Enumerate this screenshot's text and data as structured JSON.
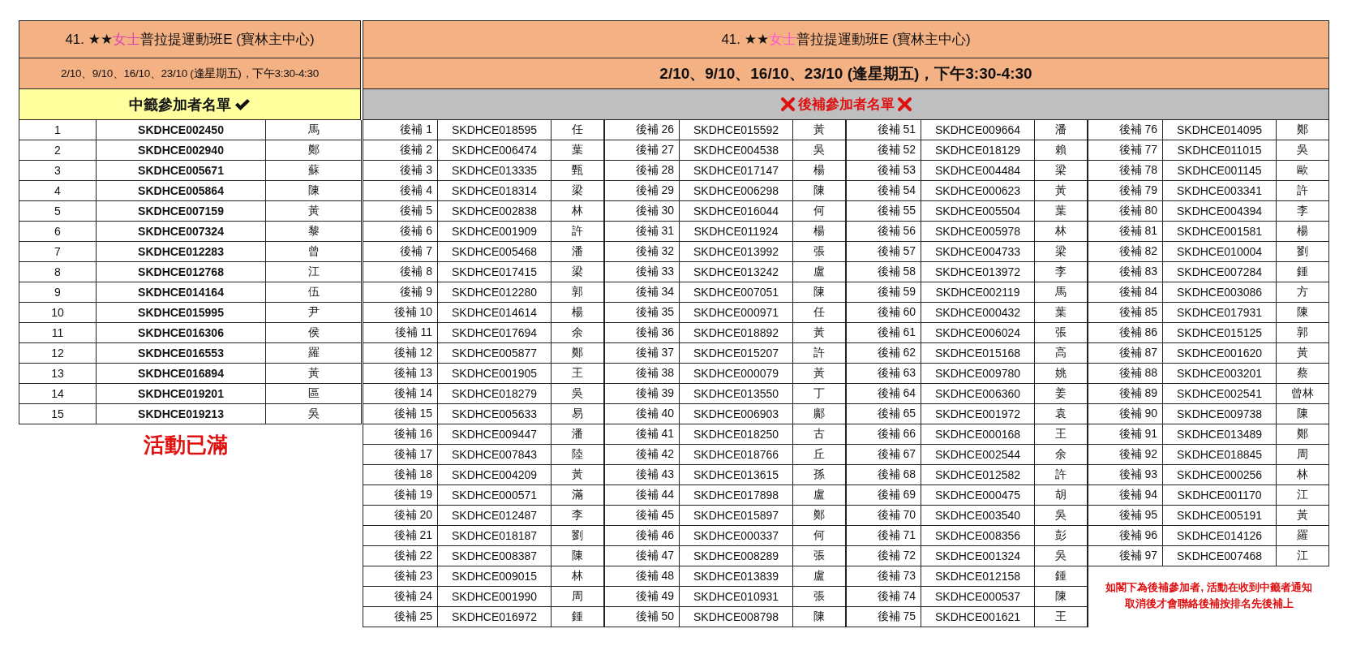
{
  "winners": {
    "title": {
      "prefix": "41. ★★",
      "highlight": "女士",
      "suffix": "普拉提運動班E (寶林主中心)"
    },
    "schedule": "2/10、9/10、16/10、23/10 (逢星期五)，下午3:30-4:30",
    "heading": "中籤參加者名單",
    "rows": [
      {
        "no": "1",
        "id": "SKDHCE002450",
        "name": "馬"
      },
      {
        "no": "2",
        "id": "SKDHCE002940",
        "name": "鄭"
      },
      {
        "no": "3",
        "id": "SKDHCE005671",
        "name": "蘇"
      },
      {
        "no": "4",
        "id": "SKDHCE005864",
        "name": "陳"
      },
      {
        "no": "5",
        "id": "SKDHCE007159",
        "name": "黃"
      },
      {
        "no": "6",
        "id": "SKDHCE007324",
        "name": "黎"
      },
      {
        "no": "7",
        "id": "SKDHCE012283",
        "name": "曾"
      },
      {
        "no": "8",
        "id": "SKDHCE012768",
        "name": "江"
      },
      {
        "no": "9",
        "id": "SKDHCE014164",
        "name": "伍"
      },
      {
        "no": "10",
        "id": "SKDHCE015995",
        "name": "尹"
      },
      {
        "no": "11",
        "id": "SKDHCE016306",
        "name": "侯"
      },
      {
        "no": "12",
        "id": "SKDHCE016553",
        "name": "羅"
      },
      {
        "no": "13",
        "id": "SKDHCE016894",
        "name": "黃"
      },
      {
        "no": "14",
        "id": "SKDHCE019201",
        "name": "區"
      },
      {
        "no": "15",
        "id": "SKDHCE019213",
        "name": "吳"
      }
    ],
    "status": "活動已滿"
  },
  "waitlist": {
    "title": {
      "prefix": "41. ★★",
      "highlight": "女士",
      "suffix": "普拉提運動班E (寶林主中心)"
    },
    "schedule": "2/10、9/10、16/10、23/10 (逢星期五)，下午3:30-4:30",
    "heading": "後補參加者名單",
    "groups": [
      {
        "rows": [
          {
            "label": "後補 1",
            "id": "SKDHCE018595",
            "name": "任"
          },
          {
            "label": "後補 2",
            "id": "SKDHCE006474",
            "name": "葉"
          },
          {
            "label": "後補 3",
            "id": "SKDHCE013335",
            "name": "甄"
          },
          {
            "label": "後補 4",
            "id": "SKDHCE018314",
            "name": "梁"
          },
          {
            "label": "後補 5",
            "id": "SKDHCE002838",
            "name": "林"
          },
          {
            "label": "後補 6",
            "id": "SKDHCE001909",
            "name": "許"
          },
          {
            "label": "後補 7",
            "id": "SKDHCE005468",
            "name": "潘"
          },
          {
            "label": "後補 8",
            "id": "SKDHCE017415",
            "name": "梁"
          },
          {
            "label": "後補 9",
            "id": "SKDHCE012280",
            "name": "郭"
          },
          {
            "label": "後補 10",
            "id": "SKDHCE014614",
            "name": "楊"
          },
          {
            "label": "後補 11",
            "id": "SKDHCE017694",
            "name": "余"
          },
          {
            "label": "後補 12",
            "id": "SKDHCE005877",
            "name": "鄭"
          },
          {
            "label": "後補 13",
            "id": "SKDHCE001905",
            "name": "王"
          },
          {
            "label": "後補 14",
            "id": "SKDHCE018279",
            "name": "吳"
          },
          {
            "label": "後補 15",
            "id": "SKDHCE005633",
            "name": "易"
          },
          {
            "label": "後補 16",
            "id": "SKDHCE009447",
            "name": "潘"
          },
          {
            "label": "後補 17",
            "id": "SKDHCE007843",
            "name": "陸"
          },
          {
            "label": "後補 18",
            "id": "SKDHCE004209",
            "name": "黃"
          },
          {
            "label": "後補 19",
            "id": "SKDHCE000571",
            "name": "滿"
          },
          {
            "label": "後補 20",
            "id": "SKDHCE012487",
            "name": "李"
          },
          {
            "label": "後補 21",
            "id": "SKDHCE018187",
            "name": "劉"
          },
          {
            "label": "後補 22",
            "id": "SKDHCE008387",
            "name": "陳"
          },
          {
            "label": "後補 23",
            "id": "SKDHCE009015",
            "name": "林"
          },
          {
            "label": "後補 24",
            "id": "SKDHCE001990",
            "name": "周"
          },
          {
            "label": "後補 25",
            "id": "SKDHCE016972",
            "name": "鍾"
          }
        ]
      },
      {
        "rows": [
          {
            "label": "後補 26",
            "id": "SKDHCE015592",
            "name": "黃"
          },
          {
            "label": "後補 27",
            "id": "SKDHCE004538",
            "name": "吳"
          },
          {
            "label": "後補 28",
            "id": "SKDHCE017147",
            "name": "楊"
          },
          {
            "label": "後補 29",
            "id": "SKDHCE006298",
            "name": "陳"
          },
          {
            "label": "後補 30",
            "id": "SKDHCE016044",
            "name": "何"
          },
          {
            "label": "後補 31",
            "id": "SKDHCE011924",
            "name": "楊"
          },
          {
            "label": "後補 32",
            "id": "SKDHCE013992",
            "name": "張"
          },
          {
            "label": "後補 33",
            "id": "SKDHCE013242",
            "name": "盧"
          },
          {
            "label": "後補 34",
            "id": "SKDHCE007051",
            "name": "陳"
          },
          {
            "label": "後補 35",
            "id": "SKDHCE000971",
            "name": "任"
          },
          {
            "label": "後補 36",
            "id": "SKDHCE018892",
            "name": "黃"
          },
          {
            "label": "後補 37",
            "id": "SKDHCE015207",
            "name": "許"
          },
          {
            "label": "後補 38",
            "id": "SKDHCE000079",
            "name": "黃"
          },
          {
            "label": "後補 39",
            "id": "SKDHCE013550",
            "name": "丁"
          },
          {
            "label": "後補 40",
            "id": "SKDHCE006903",
            "name": "鄺"
          },
          {
            "label": "後補 41",
            "id": "SKDHCE018250",
            "name": "古"
          },
          {
            "label": "後補 42",
            "id": "SKDHCE018766",
            "name": "丘"
          },
          {
            "label": "後補 43",
            "id": "SKDHCE013615",
            "name": "孫"
          },
          {
            "label": "後補 44",
            "id": "SKDHCE017898",
            "name": "盧"
          },
          {
            "label": "後補 45",
            "id": "SKDHCE015897",
            "name": "鄭"
          },
          {
            "label": "後補 46",
            "id": "SKDHCE000337",
            "name": "何"
          },
          {
            "label": "後補 47",
            "id": "SKDHCE008289",
            "name": "張"
          },
          {
            "label": "後補 48",
            "id": "SKDHCE013839",
            "name": "盧"
          },
          {
            "label": "後補 49",
            "id": "SKDHCE010931",
            "name": "張"
          },
          {
            "label": "後補 50",
            "id": "SKDHCE008798",
            "name": "陳"
          }
        ]
      },
      {
        "rows": [
          {
            "label": "後補 51",
            "id": "SKDHCE009664",
            "name": "潘"
          },
          {
            "label": "後補 52",
            "id": "SKDHCE018129",
            "name": "賴"
          },
          {
            "label": "後補 53",
            "id": "SKDHCE004484",
            "name": "梁"
          },
          {
            "label": "後補 54",
            "id": "SKDHCE000623",
            "name": "黃"
          },
          {
            "label": "後補 55",
            "id": "SKDHCE005504",
            "name": "葉"
          },
          {
            "label": "後補 56",
            "id": "SKDHCE005978",
            "name": "林"
          },
          {
            "label": "後補 57",
            "id": "SKDHCE004733",
            "name": "梁"
          },
          {
            "label": "後補 58",
            "id": "SKDHCE013972",
            "name": "李"
          },
          {
            "label": "後補 59",
            "id": "SKDHCE002119",
            "name": "馬"
          },
          {
            "label": "後補 60",
            "id": "SKDHCE000432",
            "name": "葉"
          },
          {
            "label": "後補 61",
            "id": "SKDHCE006024",
            "name": "張"
          },
          {
            "label": "後補 62",
            "id": "SKDHCE015168",
            "name": "高"
          },
          {
            "label": "後補 63",
            "id": "SKDHCE009780",
            "name": "姚"
          },
          {
            "label": "後補 64",
            "id": "SKDHCE006360",
            "name": "姜"
          },
          {
            "label": "後補 65",
            "id": "SKDHCE001972",
            "name": "袁"
          },
          {
            "label": "後補 66",
            "id": "SKDHCE000168",
            "name": "王"
          },
          {
            "label": "後補 67",
            "id": "SKDHCE002544",
            "name": "余"
          },
          {
            "label": "後補 68",
            "id": "SKDHCE012582",
            "name": "許"
          },
          {
            "label": "後補 69",
            "id": "SKDHCE000475",
            "name": "胡"
          },
          {
            "label": "後補 70",
            "id": "SKDHCE003540",
            "name": "吳"
          },
          {
            "label": "後補 71",
            "id": "SKDHCE008356",
            "name": "彭"
          },
          {
            "label": "後補 72",
            "id": "SKDHCE001324",
            "name": "吳"
          },
          {
            "label": "後補 73",
            "id": "SKDHCE012158",
            "name": "鍾"
          },
          {
            "label": "後補 74",
            "id": "SKDHCE000537",
            "name": "陳"
          },
          {
            "label": "後補 75",
            "id": "SKDHCE001621",
            "name": "王"
          }
        ]
      },
      {
        "rows": [
          {
            "label": "後補 76",
            "id": "SKDHCE014095",
            "name": "鄭"
          },
          {
            "label": "後補 77",
            "id": "SKDHCE011015",
            "name": "吳"
          },
          {
            "label": "後補 78",
            "id": "SKDHCE001145",
            "name": "歐"
          },
          {
            "label": "後補 79",
            "id": "SKDHCE003341",
            "name": "許"
          },
          {
            "label": "後補 80",
            "id": "SKDHCE004394",
            "name": "李"
          },
          {
            "label": "後補 81",
            "id": "SKDHCE001581",
            "name": "楊"
          },
          {
            "label": "後補 82",
            "id": "SKDHCE010004",
            "name": "劉"
          },
          {
            "label": "後補 83",
            "id": "SKDHCE007284",
            "name": "鍾"
          },
          {
            "label": "後補 84",
            "id": "SKDHCE003086",
            "name": "方"
          },
          {
            "label": "後補 85",
            "id": "SKDHCE017931",
            "name": "陳"
          },
          {
            "label": "後補 86",
            "id": "SKDHCE015125",
            "name": "郭"
          },
          {
            "label": "後補 87",
            "id": "SKDHCE001620",
            "name": "黃"
          },
          {
            "label": "後補 88",
            "id": "SKDHCE003201",
            "name": "蔡"
          },
          {
            "label": "後補 89",
            "id": "SKDHCE002541",
            "name": "曾林"
          },
          {
            "label": "後補 90",
            "id": "SKDHCE009738",
            "name": "陳"
          },
          {
            "label": "後補 91",
            "id": "SKDHCE013489",
            "name": "鄭"
          },
          {
            "label": "後補 92",
            "id": "SKDHCE018845",
            "name": "周"
          },
          {
            "label": "後補 93",
            "id": "SKDHCE000256",
            "name": "林"
          },
          {
            "label": "後補 94",
            "id": "SKDHCE001170",
            "name": "江"
          },
          {
            "label": "後補 95",
            "id": "SKDHCE005191",
            "name": "黃"
          },
          {
            "label": "後補 96",
            "id": "SKDHCE014126",
            "name": "羅"
          },
          {
            "label": "後補 97",
            "id": "SKDHCE007468",
            "name": "江"
          }
        ],
        "note": "如閣下為後補參加者, 活動在收到中籤者通知取消後才會聯絡後補按排名先後補上"
      }
    ]
  }
}
